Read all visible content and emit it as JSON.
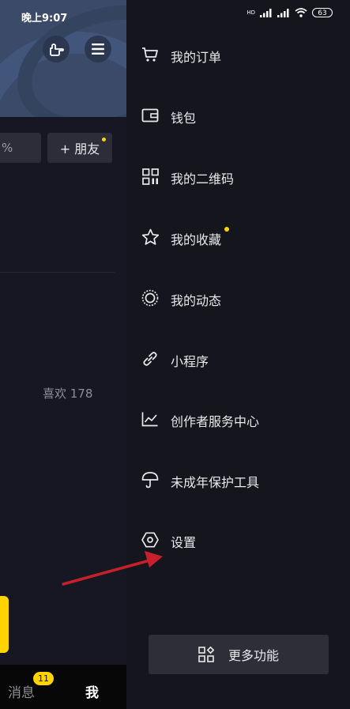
{
  "status_bar": {
    "time": "晚上9:07",
    "battery": "63",
    "network_label": "HD"
  },
  "profile": {
    "edit_stub_text": "%",
    "add_friend_label": "+ 朋友",
    "likes_label": "喜欢 178"
  },
  "bottom_nav": {
    "messages_label": "消息",
    "messages_badge": "11",
    "me_label": "我"
  },
  "drawer": {
    "items": [
      {
        "label": "我的订单",
        "icon": "cart-icon"
      },
      {
        "label": "钱包",
        "icon": "wallet-icon"
      },
      {
        "label": "我的二维码",
        "icon": "qr-code-icon"
      },
      {
        "label": "我的收藏",
        "icon": "star-icon",
        "has_dot": true
      },
      {
        "label": "我的动态",
        "icon": "activity-ring-icon"
      },
      {
        "label": "小程序",
        "icon": "link-icon"
      },
      {
        "label": "创作者服务中心",
        "icon": "trend-chart-icon"
      },
      {
        "label": "未成年保护工具",
        "icon": "umbrella-icon"
      },
      {
        "label": "设置",
        "icon": "settings-hexagon-icon"
      }
    ],
    "more_label": "更多功能"
  },
  "colors": {
    "background": "#161722",
    "drawer": "#15151d",
    "accent_yellow": "#ffd400",
    "annotation_arrow": "#c8202a"
  }
}
